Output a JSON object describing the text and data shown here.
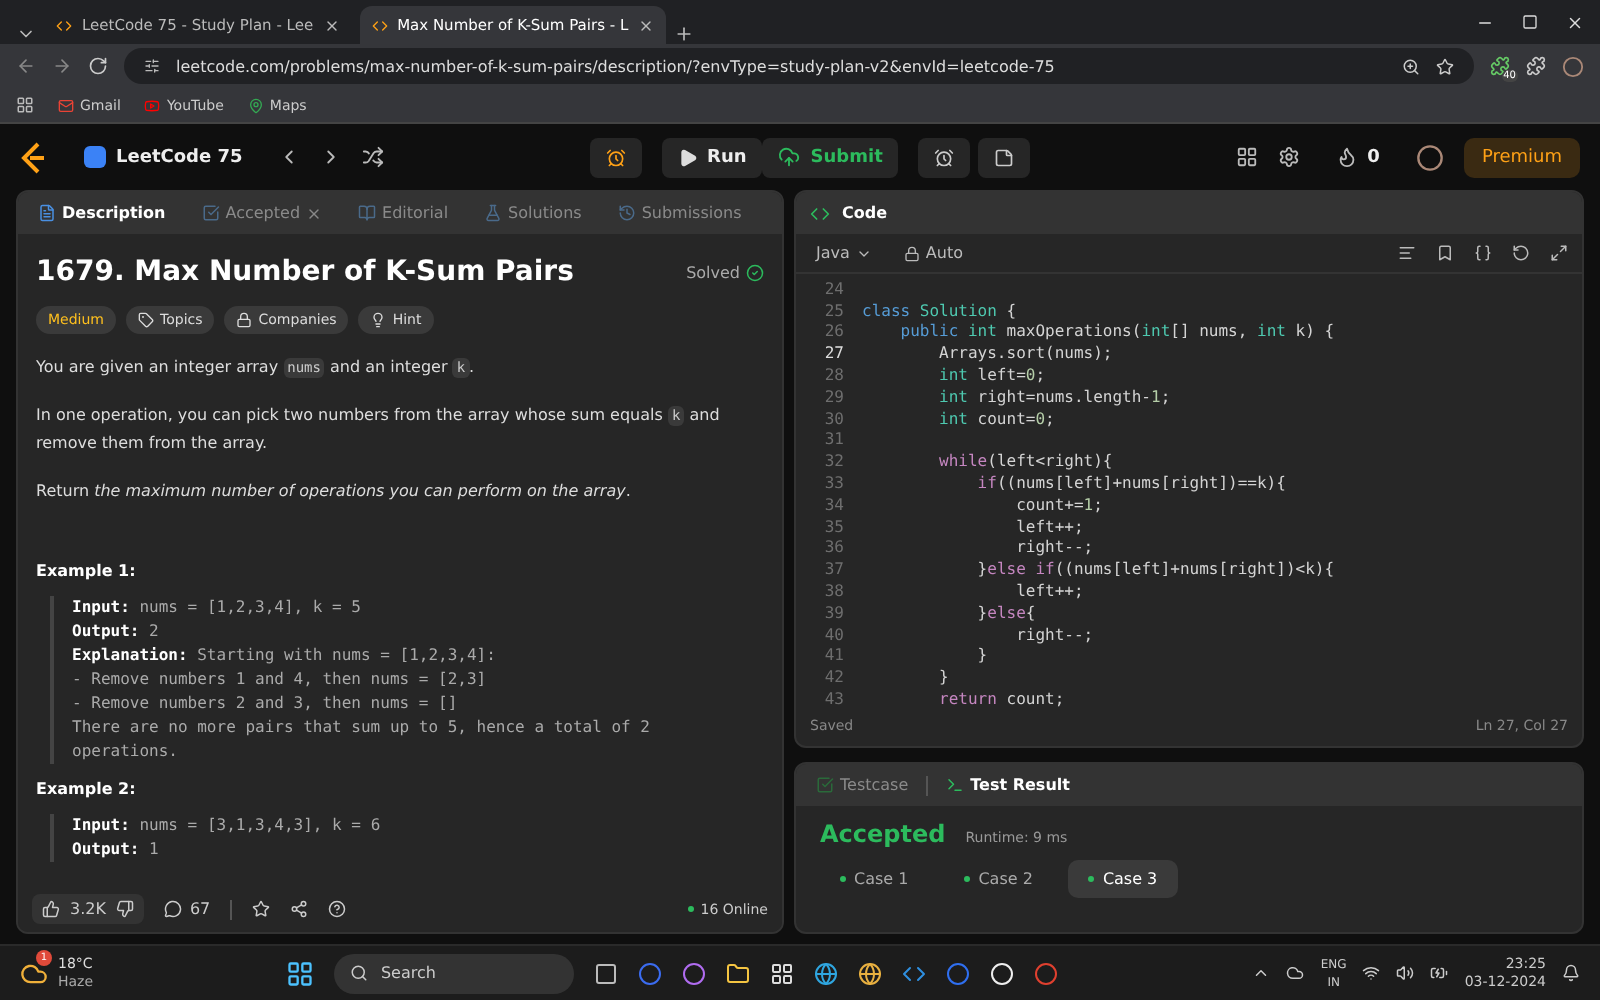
{
  "browser": {
    "tabs": [
      {
        "title": "LeetCode 75 - Study Plan - Lee",
        "selected": false
      },
      {
        "title": "Max Number of K-Sum Pairs - L",
        "selected": true
      }
    ],
    "url": "leetcode.com/problems/max-number-of-k-sum-pairs/description/?envType=study-plan-v2&envId=leetcode-75",
    "extension_badge": "40",
    "bookmarks": [
      {
        "label": "Gmail",
        "kind": "mail"
      },
      {
        "label": "YouTube",
        "kind": "video"
      },
      {
        "label": "Maps",
        "kind": "map"
      }
    ]
  },
  "app_bar": {
    "study_plan": "LeetCode 75",
    "run": "Run",
    "submit": "Submit",
    "streak": "0",
    "premium": "Premium"
  },
  "description_panel": {
    "tabs": [
      {
        "label": "Description",
        "kind": "doc",
        "closable": false,
        "selected": true
      },
      {
        "label": "Accepted",
        "kind": "check",
        "closable": true,
        "selected": false
      },
      {
        "label": "Editorial",
        "kind": "book",
        "closable": false,
        "selected": false
      },
      {
        "label": "Solutions",
        "kind": "flask",
        "closable": false,
        "selected": false
      },
      {
        "label": "Submissions",
        "kind": "history",
        "closable": false,
        "selected": false
      }
    ],
    "title": "1679. Max Number of K-Sum Pairs",
    "status": "Solved",
    "tags": [
      {
        "label": "Medium",
        "kind": "difficulty"
      },
      {
        "label": "Topics",
        "kind": "tag"
      },
      {
        "label": "Companies",
        "kind": "lock"
      },
      {
        "label": "Hint",
        "kind": "bulb"
      }
    ],
    "paragraphs": [
      [
        {
          "text": "You are given an integer array ",
          "kind": "text"
        },
        {
          "text": "nums",
          "kind": "code"
        },
        {
          "text": " and an integer ",
          "kind": "text"
        },
        {
          "text": "k",
          "kind": "code"
        },
        {
          "text": ".",
          "kind": "text"
        }
      ],
      [
        {
          "text": "In one operation, you can pick two numbers from the array whose sum equals ",
          "kind": "text"
        },
        {
          "text": "k",
          "kind": "code"
        },
        {
          "text": " and remove them from the array.",
          "kind": "text"
        }
      ],
      [
        {
          "text": "Return *the maximum number of operations you can perform on the array*.",
          "kind": "text"
        }
      ]
    ],
    "examples": [
      {
        "title": "Example 1:",
        "lines": [
          "**Input:** nums = [1,2,3,4], k = 5",
          "**Output:** 2",
          "**Explanation:** Starting with nums = [1,2,3,4]:",
          "- Remove numbers 1 and 4, then nums = [2,3]",
          "- Remove numbers 2 and 3, then nums = []",
          "There are no more pairs that sum up to 5, hence a total of 2 operations."
        ]
      },
      {
        "title": "Example 2:",
        "lines": [
          "**Input:** nums = [3,1,3,4,3], k = 6",
          "**Output:** 1"
        ]
      }
    ],
    "likes": "3.2K",
    "comments": "67",
    "online": "16 Online"
  },
  "code_panel": {
    "title": "Code",
    "language": "Java",
    "mode": "Auto",
    "lines": [
      {
        "number": "24",
        "current": false
      },
      {
        "number": "25",
        "current": false,
        "tokens": [
          {
            "text": "class ",
            "kind": "keyword"
          },
          {
            "text": "Solution",
            "kind": "type"
          },
          {
            "text": " {",
            "kind": "plain"
          }
        ]
      },
      {
        "number": "26",
        "current": false,
        "tokens": [
          {
            "text": "    public ",
            "kind": "keyword"
          },
          {
            "text": "int",
            "kind": "type"
          },
          {
            "text": " maxOperations(",
            "kind": "plain"
          },
          {
            "text": "int",
            "kind": "type"
          },
          {
            "text": "[] nums, ",
            "kind": "plain"
          },
          {
            "text": "int",
            "kind": "type"
          },
          {
            "text": " k) {",
            "kind": "plain"
          }
        ]
      },
      {
        "number": "27",
        "current": true,
        "tokens": [
          {
            "text": "        Arrays.sort(nums);",
            "kind": "plain"
          }
        ]
      },
      {
        "number": "28",
        "current": false,
        "tokens": [
          {
            "text": "        int",
            "kind": "type"
          },
          {
            "text": " left=",
            "kind": "plain"
          },
          {
            "text": "0",
            "kind": "number"
          },
          {
            "text": ";",
            "kind": "plain"
          }
        ]
      },
      {
        "number": "29",
        "current": false,
        "tokens": [
          {
            "text": "        int",
            "kind": "type"
          },
          {
            "text": " right=nums.length-",
            "kind": "plain"
          },
          {
            "text": "1",
            "kind": "number"
          },
          {
            "text": ";",
            "kind": "plain"
          }
        ]
      },
      {
        "number": "30",
        "current": false,
        "tokens": [
          {
            "text": "        int",
            "kind": "type"
          },
          {
            "text": " count=",
            "kind": "plain"
          },
          {
            "text": "0",
            "kind": "number"
          },
          {
            "text": ";",
            "kind": "plain"
          }
        ]
      },
      {
        "number": "31",
        "current": false
      },
      {
        "number": "32",
        "current": false,
        "tokens": [
          {
            "text": "        while",
            "kind": "control"
          },
          {
            "text": "(left<right){",
            "kind": "plain"
          }
        ]
      },
      {
        "number": "33",
        "current": false,
        "tokens": [
          {
            "text": "            if",
            "kind": "control"
          },
          {
            "text": "((nums[left]+nums[right])==k){",
            "kind": "plain"
          }
        ]
      },
      {
        "number": "34",
        "current": false,
        "tokens": [
          {
            "text": "                count+=",
            "kind": "plain"
          },
          {
            "text": "1",
            "kind": "number"
          },
          {
            "text": ";",
            "kind": "plain"
          }
        ]
      },
      {
        "number": "35",
        "current": false,
        "tokens": [
          {
            "text": "                left++;",
            "kind": "plain"
          }
        ]
      },
      {
        "number": "36",
        "current": false,
        "tokens": [
          {
            "text": "                right--;",
            "kind": "plain"
          }
        ]
      },
      {
        "number": "37",
        "current": false,
        "tokens": [
          {
            "text": "            }",
            "kind": "plain"
          },
          {
            "text": "else if",
            "kind": "control"
          },
          {
            "text": "((nums[left]+nums[right])<k){",
            "kind": "plain"
          }
        ]
      },
      {
        "number": "38",
        "current": false,
        "tokens": [
          {
            "text": "                left++;",
            "kind": "plain"
          }
        ]
      },
      {
        "number": "39",
        "current": false,
        "tokens": [
          {
            "text": "            }",
            "kind": "plain"
          },
          {
            "text": "else",
            "kind": "control"
          },
          {
            "text": "{",
            "kind": "plain"
          }
        ]
      },
      {
        "number": "40",
        "current": false,
        "tokens": [
          {
            "text": "                right--;",
            "kind": "plain"
          }
        ]
      },
      {
        "number": "41",
        "current": false,
        "tokens": [
          {
            "text": "            }",
            "kind": "plain"
          }
        ]
      },
      {
        "number": "42",
        "current": false,
        "tokens": [
          {
            "text": "        }",
            "kind": "plain"
          }
        ]
      },
      {
        "number": "43",
        "current": false,
        "tokens": [
          {
            "text": "        return",
            "kind": "control"
          },
          {
            "text": " count;",
            "kind": "plain"
          }
        ]
      }
    ],
    "save_status": "Saved",
    "cursor": "Ln 27, Col 27"
  },
  "result_panel": {
    "tabs": [
      {
        "label": "Testcase",
        "kind": "check",
        "selected": false
      },
      {
        "label": "Test Result",
        "kind": "terminal",
        "selected": true
      }
    ],
    "verdict": "Accepted",
    "runtime": "Runtime: 9 ms",
    "cases": [
      {
        "label": "Case 1",
        "selected": false
      },
      {
        "label": "Case 2",
        "selected": false
      },
      {
        "label": "Case 3",
        "selected": true
      }
    ]
  },
  "taskbar": {
    "weather_badge": "1",
    "temperature": "18°C",
    "condition": "Haze",
    "search": "Search",
    "language": "ENG",
    "region": "IN",
    "time": "23:25",
    "date": "03-12-2024"
  }
}
